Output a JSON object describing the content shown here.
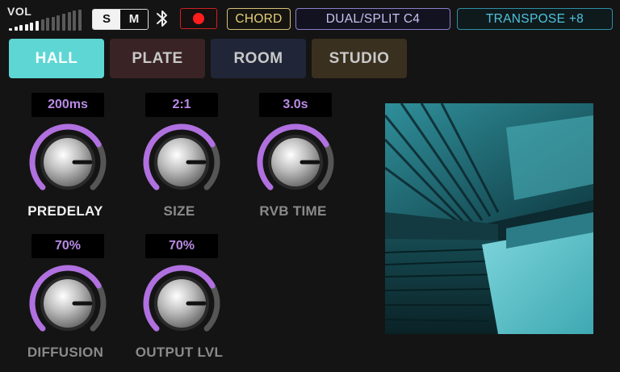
{
  "topbar": {
    "vol_label": "VOL",
    "volume_level": 6,
    "volume_steps": 14,
    "solo_label": "S",
    "mute_label": "M",
    "solo_active": true,
    "bluetooth_icon": "bluetooth-icon",
    "record_icon": "record-dot-icon",
    "chord_label": "CHORD",
    "dual_split_label": "DUAL/SPLIT  C4",
    "transpose_label": "TRANSPOSE +8",
    "colors": {
      "record": "#ff1e1e",
      "chord": "#e8d07a",
      "dual": "#c9c2f0",
      "transpose": "#4fc3dc"
    }
  },
  "tabs": [
    {
      "label": "HALL",
      "active": true
    },
    {
      "label": "PLATE",
      "active": false
    },
    {
      "label": "ROOM",
      "active": false
    },
    {
      "label": "STUDIO",
      "active": false
    }
  ],
  "knobs": [
    {
      "value": "200ms",
      "label": "PREDELAY",
      "level": 0.5,
      "active": true
    },
    {
      "value": "2:1",
      "label": "SIZE",
      "level": 0.5,
      "active": false
    },
    {
      "value": "3.0s",
      "label": "RVB TIME",
      "level": 0.5,
      "active": false
    },
    {
      "value": "70%",
      "label": "DIFFUSION",
      "level": 0.5,
      "active": false
    },
    {
      "value": "70%",
      "label": "OUTPUT LVL",
      "level": 0.5,
      "active": false
    }
  ],
  "accent_color": "#b070e0",
  "hall_image_icon": "concert-hall-photo"
}
